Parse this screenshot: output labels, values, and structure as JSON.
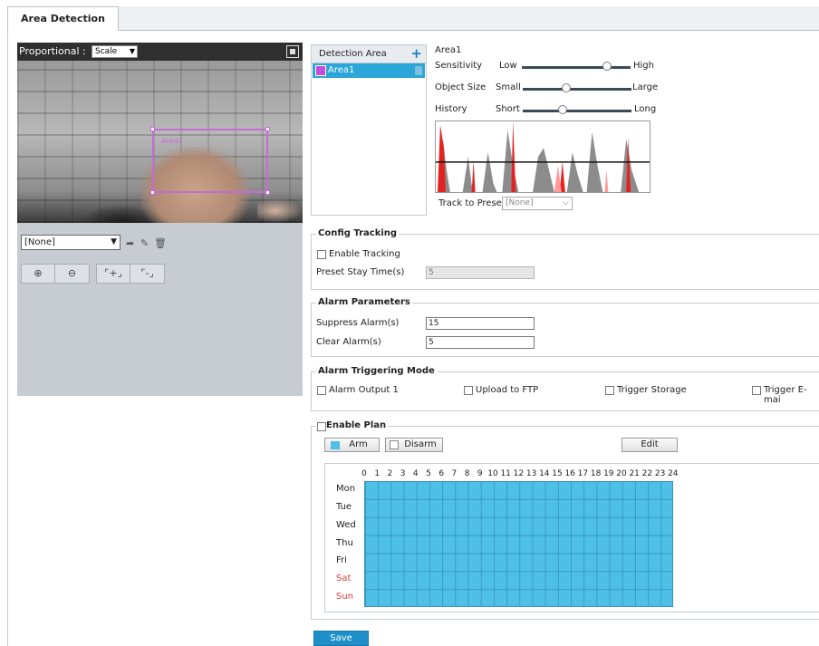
{
  "tabs": [
    {
      "label": "Area Detection"
    }
  ],
  "preview": {
    "proportional_label": "Proportional :",
    "scale_value": "Scale",
    "overlay_label": "Area1"
  },
  "ptz": {
    "preset_value": "[None]"
  },
  "detection_area": {
    "header": "Detection Area",
    "items": [
      {
        "label": "Area1",
        "color": "#c64be0",
        "selected": true
      }
    ]
  },
  "area_settings": {
    "title": "Area1",
    "sliders": [
      {
        "label": "Sensitivity",
        "low": "Low",
        "high": "High",
        "value": 0.78
      },
      {
        "label": "Object Size",
        "low": "Small",
        "high": "Large",
        "value": 0.4
      },
      {
        "label": "History",
        "low": "Short",
        "high": "Long",
        "value": 0.37
      }
    ],
    "track_to_preset_label": "Track to Preset",
    "track_to_preset_value": "[None]"
  },
  "config_tracking": {
    "title": "Config Tracking",
    "enable_label": "Enable Tracking",
    "enabled": false,
    "stay_label": "Preset Stay Time(s)",
    "stay_value": "5"
  },
  "alarm_parameters": {
    "title": "Alarm Parameters",
    "suppress_label": "Suppress Alarm(s)",
    "suppress_value": "15",
    "clear_label": "Clear Alarm(s)",
    "clear_value": "5"
  },
  "alarm_triggering": {
    "title": "Alarm Triggering Mode",
    "options": [
      {
        "label": "Alarm Output 1",
        "checked": false
      },
      {
        "label": "Upload to FTP",
        "checked": false
      },
      {
        "label": "Trigger Storage",
        "checked": false
      },
      {
        "label": "Trigger E-mai",
        "checked": false
      }
    ]
  },
  "plan": {
    "title": "Enable Plan",
    "enabled": false,
    "arm_label": "Arm",
    "disarm_label": "Disarm",
    "edit_label": "Edit",
    "hours": [
      "0",
      "1",
      "2",
      "3",
      "4",
      "5",
      "6",
      "7",
      "8",
      "9",
      "10",
      "11",
      "12",
      "13",
      "14",
      "15",
      "16",
      "17",
      "18",
      "19",
      "20",
      "21",
      "22",
      "23",
      "24"
    ],
    "days": [
      {
        "label": "Mon",
        "weekend": false
      },
      {
        "label": "Tue",
        "weekend": false
      },
      {
        "label": "Wed",
        "weekend": false
      },
      {
        "label": "Thu",
        "weekend": false
      },
      {
        "label": "Fri",
        "weekend": false
      },
      {
        "label": "Sat",
        "weekend": true
      },
      {
        "label": "Sun",
        "weekend": true
      }
    ],
    "arm_color": "#4ec0e8",
    "weekend_color": "#e03a3a"
  },
  "save_label": "Save"
}
